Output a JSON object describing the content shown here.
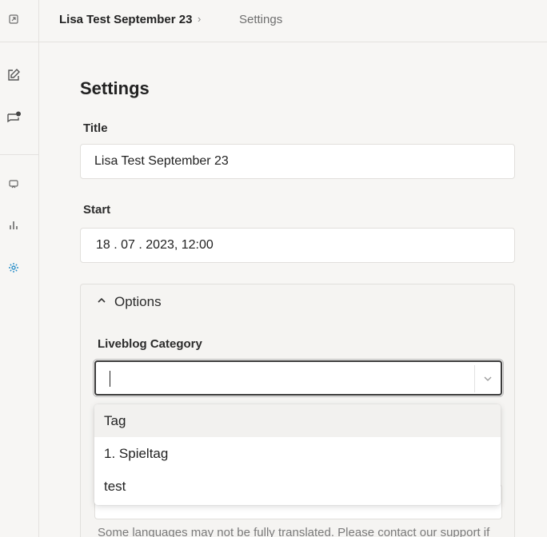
{
  "breadcrumb": {
    "item1": "Lisa Test September 23",
    "separator": "›",
    "item2": "Settings"
  },
  "sidebar": {
    "icons": [
      "exit-icon",
      "edit-icon",
      "chat-notification-icon",
      "inbox-icon",
      "bar-chart-icon",
      "settings-gear-icon"
    ],
    "active_icon": "settings-gear-icon",
    "accent_color": "#2a8fc9",
    "notification_dot_color": "#444444"
  },
  "page": {
    "title": "Settings",
    "title_field": {
      "label": "Title",
      "value": "Lisa Test September 23"
    },
    "start_field": {
      "label": "Start",
      "value": "18 . 07 . 2023, 12:00"
    },
    "options": {
      "header": "Options",
      "expanded": true,
      "category_label": "Liveblog Category",
      "category_value": "",
      "note": "Some languages may not be fully translated. Please contact our support if"
    }
  },
  "dropdown": {
    "options": [
      "Tag",
      "1. Spieltag",
      "test"
    ],
    "highlighted_index": 0
  }
}
